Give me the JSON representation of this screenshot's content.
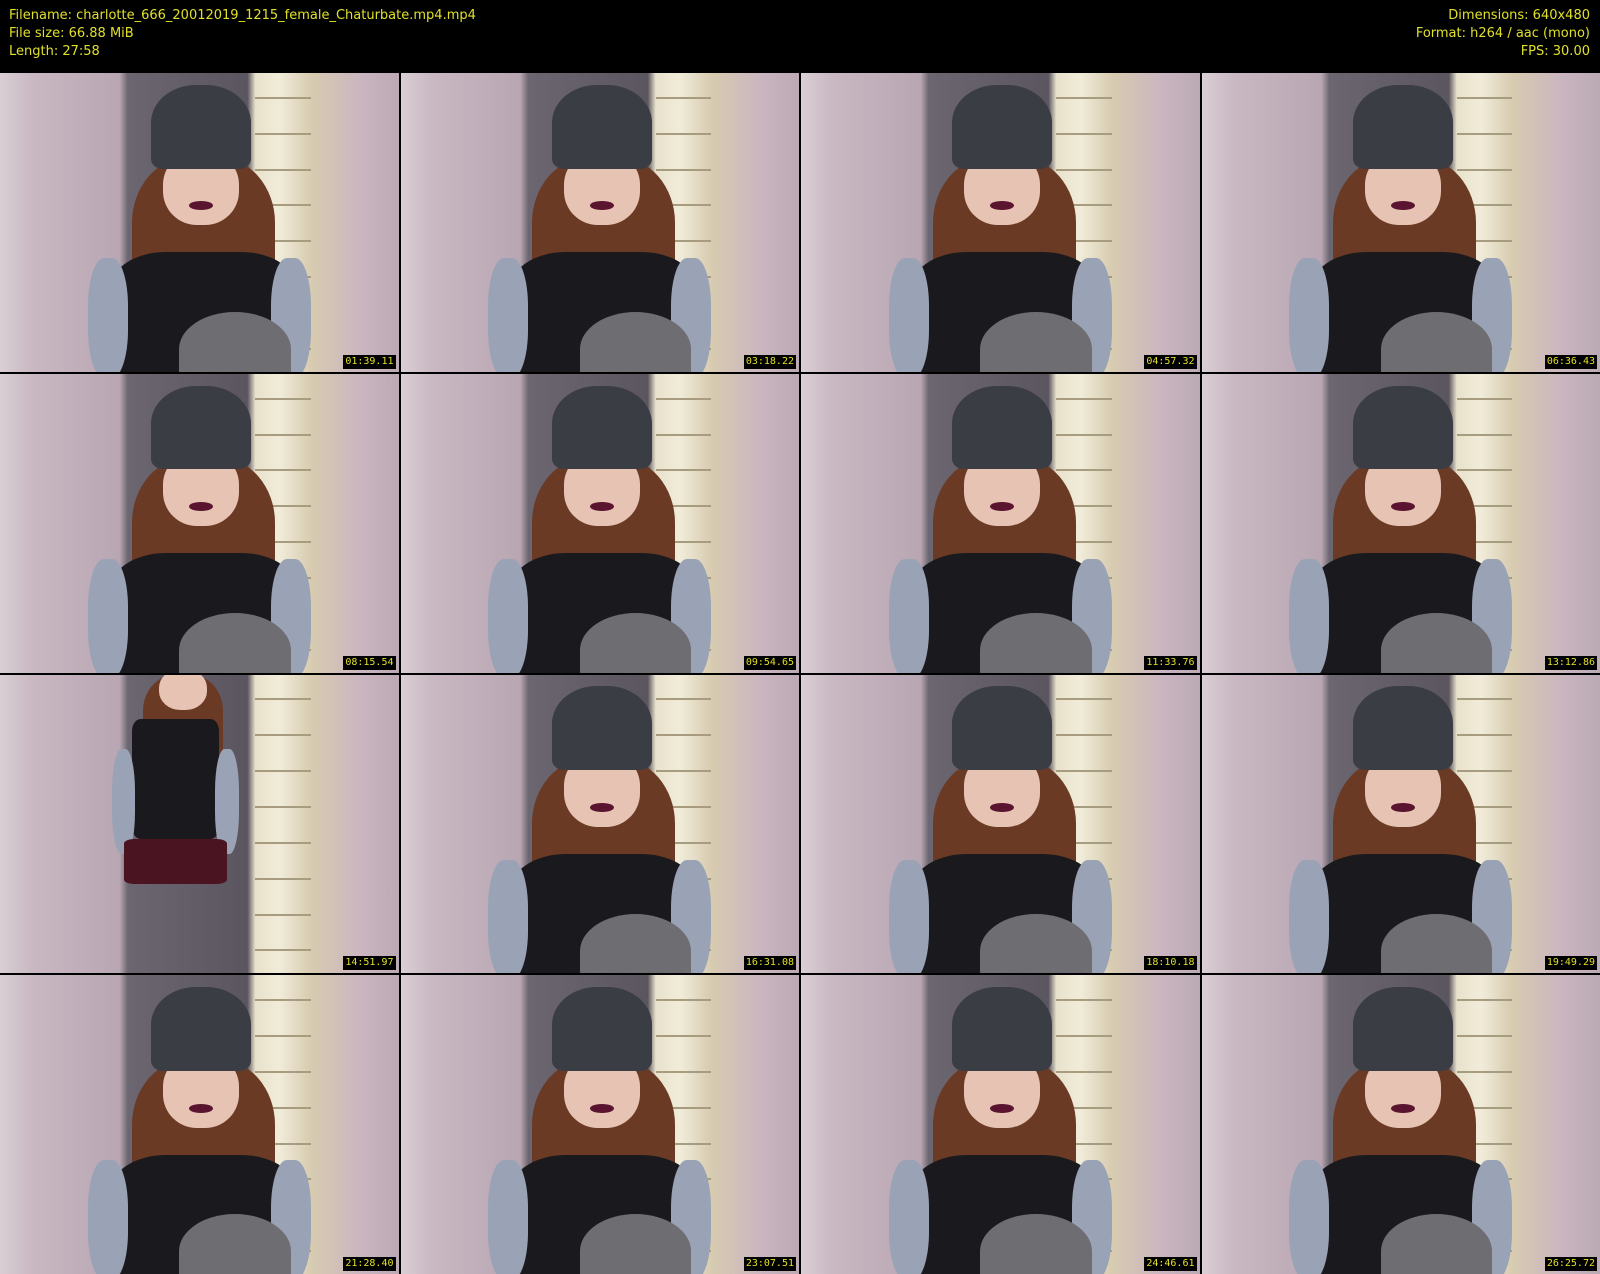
{
  "header": {
    "filename": "Filename: charlotte_666_20012019_1215_female_Chaturbate.mp4.mp4",
    "file_size": "File size: 66.88 MiB",
    "length": "Length: 27:58",
    "dimensions": "Dimensions: 640x480",
    "format": "Format: h264 / aac (mono)",
    "fps": "FPS: 30.00"
  },
  "colors": {
    "text": "#e0e02a",
    "background": "#000000"
  },
  "thumbnails": [
    {
      "timestamp": "01:39.11"
    },
    {
      "timestamp": "03:18.22"
    },
    {
      "timestamp": "04:57.32"
    },
    {
      "timestamp": "06:36.43"
    },
    {
      "timestamp": "08:15.54"
    },
    {
      "timestamp": "09:54.65"
    },
    {
      "timestamp": "11:33.76"
    },
    {
      "timestamp": "13:12.86"
    },
    {
      "timestamp": "14:51.97"
    },
    {
      "timestamp": "16:31.08"
    },
    {
      "timestamp": "18:10.18"
    },
    {
      "timestamp": "19:49.29"
    },
    {
      "timestamp": "21:28.40"
    },
    {
      "timestamp": "23:07.51"
    },
    {
      "timestamp": "24:46.61"
    },
    {
      "timestamp": "26:25.72"
    }
  ]
}
